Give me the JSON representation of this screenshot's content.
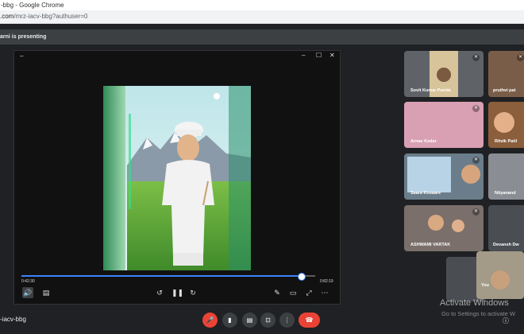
{
  "browser": {
    "title": "-bbg - Google Chrome",
    "url_host": ".com",
    "url_path": "/mrz-iacv-bbg?authuser=0"
  },
  "banner": {
    "text": "arni is presenting"
  },
  "player": {
    "time_elapsed": "0:42:30",
    "time_total": "0:82:19",
    "progress": 0.95,
    "controls": [
      "back-icon",
      "minimize-icon",
      "maximize-icon",
      "close-icon",
      "volume-icon",
      "captions-icon",
      "rewind-icon",
      "pause-icon",
      "forward-icon",
      "pen-icon",
      "crop-icon",
      "fullscreen-icon",
      "more-icon"
    ]
  },
  "participants": [
    {
      "name": "Sovit Kumar Parida",
      "color": "#5f6368"
    },
    {
      "name": "pruthvi pat",
      "color": "#7a5d48"
    },
    {
      "name": "Arnav Kedar",
      "color": "#d9a0b4"
    },
    {
      "name": "Ritvik Patil",
      "color": "#8b5e3c"
    },
    {
      "name": "Saara Kosaare",
      "color": "#6b7d8a"
    },
    {
      "name": "Nityanand",
      "color": "#8a8e94"
    },
    {
      "name": "ASHWAMI VARTAK",
      "color": "#7a6f6a"
    },
    {
      "name": "Devansh Dw",
      "color": "#4a4d52"
    },
    {
      "name": "You",
      "color": "#a39a88"
    }
  ],
  "meeting": {
    "code": "-iacv-bbg"
  },
  "watermark": {
    "line1": "Activate Windows",
    "line2": "Go to Settings to activate W"
  }
}
